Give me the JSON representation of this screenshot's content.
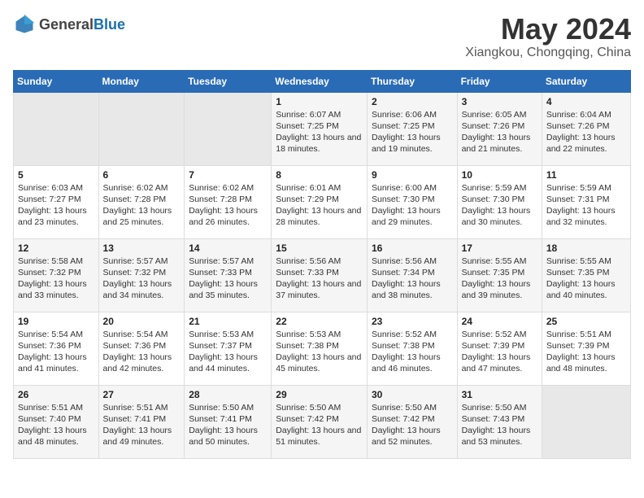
{
  "header": {
    "logo_general": "General",
    "logo_blue": "Blue",
    "main_title": "May 2024",
    "subtitle": "Xiangkou, Chongqing, China"
  },
  "days_of_week": [
    "Sunday",
    "Monday",
    "Tuesday",
    "Wednesday",
    "Thursday",
    "Friday",
    "Saturday"
  ],
  "weeks": [
    [
      {
        "day": "",
        "empty": true
      },
      {
        "day": "",
        "empty": true
      },
      {
        "day": "",
        "empty": true
      },
      {
        "day": "1",
        "sunrise": "6:07 AM",
        "sunset": "7:25 PM",
        "daylight": "13 hours and 18 minutes."
      },
      {
        "day": "2",
        "sunrise": "6:06 AM",
        "sunset": "7:25 PM",
        "daylight": "13 hours and 19 minutes."
      },
      {
        "day": "3",
        "sunrise": "6:05 AM",
        "sunset": "7:26 PM",
        "daylight": "13 hours and 21 minutes."
      },
      {
        "day": "4",
        "sunrise": "6:04 AM",
        "sunset": "7:26 PM",
        "daylight": "13 hours and 22 minutes."
      }
    ],
    [
      {
        "day": "5",
        "sunrise": "6:03 AM",
        "sunset": "7:27 PM",
        "daylight": "13 hours and 23 minutes."
      },
      {
        "day": "6",
        "sunrise": "6:02 AM",
        "sunset": "7:28 PM",
        "daylight": "13 hours and 25 minutes."
      },
      {
        "day": "7",
        "sunrise": "6:02 AM",
        "sunset": "7:28 PM",
        "daylight": "13 hours and 26 minutes."
      },
      {
        "day": "8",
        "sunrise": "6:01 AM",
        "sunset": "7:29 PM",
        "daylight": "13 hours and 28 minutes."
      },
      {
        "day": "9",
        "sunrise": "6:00 AM",
        "sunset": "7:30 PM",
        "daylight": "13 hours and 29 minutes."
      },
      {
        "day": "10",
        "sunrise": "5:59 AM",
        "sunset": "7:30 PM",
        "daylight": "13 hours and 30 minutes."
      },
      {
        "day": "11",
        "sunrise": "5:59 AM",
        "sunset": "7:31 PM",
        "daylight": "13 hours and 32 minutes."
      }
    ],
    [
      {
        "day": "12",
        "sunrise": "5:58 AM",
        "sunset": "7:32 PM",
        "daylight": "13 hours and 33 minutes."
      },
      {
        "day": "13",
        "sunrise": "5:57 AM",
        "sunset": "7:32 PM",
        "daylight": "13 hours and 34 minutes."
      },
      {
        "day": "14",
        "sunrise": "5:57 AM",
        "sunset": "7:33 PM",
        "daylight": "13 hours and 35 minutes."
      },
      {
        "day": "15",
        "sunrise": "5:56 AM",
        "sunset": "7:33 PM",
        "daylight": "13 hours and 37 minutes."
      },
      {
        "day": "16",
        "sunrise": "5:56 AM",
        "sunset": "7:34 PM",
        "daylight": "13 hours and 38 minutes."
      },
      {
        "day": "17",
        "sunrise": "5:55 AM",
        "sunset": "7:35 PM",
        "daylight": "13 hours and 39 minutes."
      },
      {
        "day": "18",
        "sunrise": "5:55 AM",
        "sunset": "7:35 PM",
        "daylight": "13 hours and 40 minutes."
      }
    ],
    [
      {
        "day": "19",
        "sunrise": "5:54 AM",
        "sunset": "7:36 PM",
        "daylight": "13 hours and 41 minutes."
      },
      {
        "day": "20",
        "sunrise": "5:54 AM",
        "sunset": "7:36 PM",
        "daylight": "13 hours and 42 minutes."
      },
      {
        "day": "21",
        "sunrise": "5:53 AM",
        "sunset": "7:37 PM",
        "daylight": "13 hours and 44 minutes."
      },
      {
        "day": "22",
        "sunrise": "5:53 AM",
        "sunset": "7:38 PM",
        "daylight": "13 hours and 45 minutes."
      },
      {
        "day": "23",
        "sunrise": "5:52 AM",
        "sunset": "7:38 PM",
        "daylight": "13 hours and 46 minutes."
      },
      {
        "day": "24",
        "sunrise": "5:52 AM",
        "sunset": "7:39 PM",
        "daylight": "13 hours and 47 minutes."
      },
      {
        "day": "25",
        "sunrise": "5:51 AM",
        "sunset": "7:39 PM",
        "daylight": "13 hours and 48 minutes."
      }
    ],
    [
      {
        "day": "26",
        "sunrise": "5:51 AM",
        "sunset": "7:40 PM",
        "daylight": "13 hours and 48 minutes."
      },
      {
        "day": "27",
        "sunrise": "5:51 AM",
        "sunset": "7:41 PM",
        "daylight": "13 hours and 49 minutes."
      },
      {
        "day": "28",
        "sunrise": "5:50 AM",
        "sunset": "7:41 PM",
        "daylight": "13 hours and 50 minutes."
      },
      {
        "day": "29",
        "sunrise": "5:50 AM",
        "sunset": "7:42 PM",
        "daylight": "13 hours and 51 minutes."
      },
      {
        "day": "30",
        "sunrise": "5:50 AM",
        "sunset": "7:42 PM",
        "daylight": "13 hours and 52 minutes."
      },
      {
        "day": "31",
        "sunrise": "5:50 AM",
        "sunset": "7:43 PM",
        "daylight": "13 hours and 53 minutes."
      },
      {
        "day": "",
        "empty": true
      }
    ]
  ]
}
